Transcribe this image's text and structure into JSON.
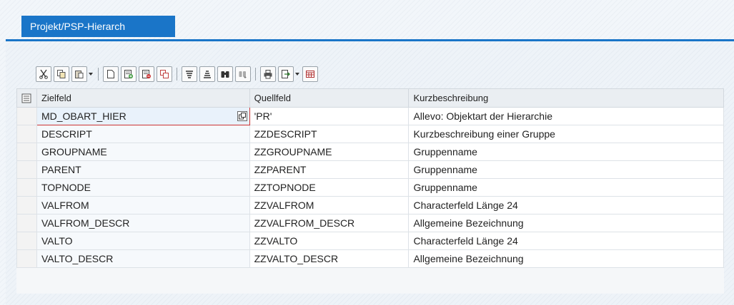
{
  "tab": {
    "label": "Projekt/PSP-Hierarch"
  },
  "toolbar": {
    "buttons": [
      {
        "icon": "cut-icon"
      },
      {
        "icon": "copy-icon"
      },
      {
        "icon": "paste-icon",
        "dropdown": true
      },
      {
        "icon": "new-document-icon"
      },
      {
        "icon": "append-row-icon"
      },
      {
        "icon": "delete-row-icon"
      },
      {
        "icon": "copy-row-icon"
      },
      {
        "icon": "sort-ascending-icon"
      },
      {
        "icon": "sort-descending-icon"
      },
      {
        "icon": "find-icon"
      },
      {
        "icon": "find-next-icon"
      },
      {
        "icon": "print-icon"
      },
      {
        "icon": "export-icon",
        "dropdown": true
      },
      {
        "icon": "layout-icon"
      }
    ]
  },
  "table": {
    "columns": [
      "Zielfeld",
      "Quellfeld",
      "Kurzbeschreibung"
    ],
    "rows": [
      {
        "ziel": "MD_OBART_HIER",
        "quell": "'PR'",
        "kurz": "Allevo: Objektart der Hierarchie"
      },
      {
        "ziel": "DESCRIPT",
        "quell": "ZZDESCRIPT",
        "kurz": "Kurzbeschreibung einer Gruppe"
      },
      {
        "ziel": "GROUPNAME",
        "quell": "ZZGROUPNAME",
        "kurz": "Gruppenname"
      },
      {
        "ziel": "PARENT",
        "quell": "ZZPARENT",
        "kurz": "Gruppenname"
      },
      {
        "ziel": "TOPNODE",
        "quell": "ZZTOPNODE",
        "kurz": "Gruppenname"
      },
      {
        "ziel": "VALFROM",
        "quell": "ZZVALFROM",
        "kurz": "Characterfeld Länge 24"
      },
      {
        "ziel": "VALFROM_DESCR",
        "quell": "ZZVALFROM_DESCR",
        "kurz": "Allgemeine Bezeichnung"
      },
      {
        "ziel": "VALTO",
        "quell": "ZZVALTO",
        "kurz": "Characterfeld Länge 24"
      },
      {
        "ziel": "VALTO_DESCR",
        "quell": "ZZVALTO_DESCR",
        "kurz": "Allgemeine Bezeichnung"
      }
    ]
  },
  "colors": {
    "accent": "#1a75c8",
    "active_border": "#cc3333"
  }
}
